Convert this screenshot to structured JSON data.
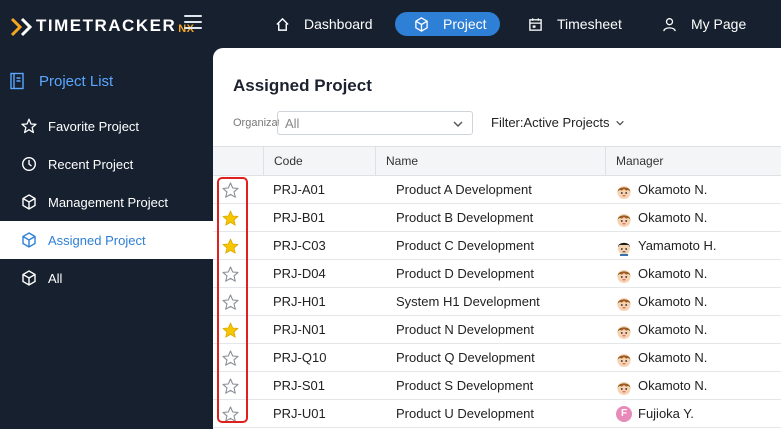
{
  "app": {
    "logo_text": "TIMETRACKER",
    "logo_suffix": "NX"
  },
  "nav": [
    {
      "label": "Dashboard",
      "icon": "home-icon"
    },
    {
      "label": "Project",
      "icon": "cube-icon",
      "active": true
    },
    {
      "label": "Timesheet",
      "icon": "calendar-icon"
    },
    {
      "label": "My Page",
      "icon": "user-icon"
    }
  ],
  "sidebar": {
    "header": "Project List",
    "items": [
      {
        "label": "Favorite Project",
        "icon": "star-icon"
      },
      {
        "label": "Recent Project",
        "icon": "clock-icon"
      },
      {
        "label": "Management Project",
        "icon": "cube-icon"
      },
      {
        "label": "Assigned Project",
        "icon": "cube-icon",
        "active": true
      },
      {
        "label": "All",
        "icon": "cube-icon"
      }
    ]
  },
  "main": {
    "title": "Assigned Project",
    "org_label": "Organization",
    "org_value": "All",
    "filter_label": "Filter:Active Projects"
  },
  "table": {
    "columns": [
      "Code",
      "Name",
      "Manager"
    ],
    "rows": [
      {
        "favorite": false,
        "code": "PRJ-A01",
        "name": "Product A Development",
        "manager": "Okamoto N.",
        "avatar": "okamoto"
      },
      {
        "favorite": true,
        "code": "PRJ-B01",
        "name": "Product B Development",
        "manager": "Okamoto N.",
        "avatar": "okamoto"
      },
      {
        "favorite": true,
        "code": "PRJ-C03",
        "name": "Product C Development",
        "manager": "Yamamoto H.",
        "avatar": "yamamoto"
      },
      {
        "favorite": false,
        "code": "PRJ-D04",
        "name": "Product D Development",
        "manager": "Okamoto N.",
        "avatar": "okamoto"
      },
      {
        "favorite": false,
        "code": "PRJ-H01",
        "name": "System H1 Development",
        "manager": "Okamoto N.",
        "avatar": "okamoto"
      },
      {
        "favorite": true,
        "code": "PRJ-N01",
        "name": "Product N Development",
        "manager": "Okamoto N.",
        "avatar": "okamoto"
      },
      {
        "favorite": false,
        "code": "PRJ-Q10",
        "name": "Product Q Development",
        "manager": "Okamoto N.",
        "avatar": "okamoto"
      },
      {
        "favorite": false,
        "code": "PRJ-S01",
        "name": "Product S Development",
        "manager": "Okamoto N.",
        "avatar": "okamoto"
      },
      {
        "favorite": false,
        "code": "PRJ-U01",
        "name": "Product U Development",
        "manager": "Fujioka Y.",
        "avatar": "fujioka",
        "avatar_letter": "F"
      }
    ]
  },
  "colors": {
    "accent": "#2e7fd6",
    "sidebar_bg": "#16202e",
    "star_on": "#f7c600",
    "highlight": "#e0201c"
  }
}
